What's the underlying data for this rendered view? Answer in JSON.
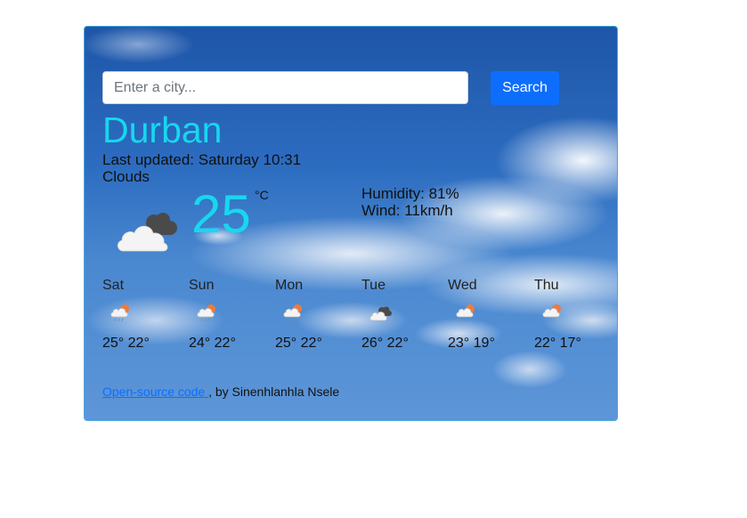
{
  "search": {
    "placeholder": "Enter a city...",
    "value": "",
    "button_label": "Search"
  },
  "current": {
    "city": "Durban",
    "last_updated_label": "Last updated:",
    "last_updated_value": "Saturday 10:31",
    "description": "Clouds",
    "icon": "broken-clouds-icon",
    "temperature": "25",
    "unit": "°C",
    "humidity_label": "Humidity:",
    "humidity_value": "81%",
    "wind_label": "Wind:",
    "wind_value": "11km/h"
  },
  "forecast": [
    {
      "day": "Sat",
      "icon": "light-rain-icon",
      "max": "25°",
      "min": "22°"
    },
    {
      "day": "Sun",
      "icon": "light-rain-icon",
      "max": "24°",
      "min": "22°"
    },
    {
      "day": "Mon",
      "icon": "light-rain-icon",
      "max": "25°",
      "min": "22°"
    },
    {
      "day": "Tue",
      "icon": "broken-clouds-icon",
      "max": "26°",
      "min": "22°"
    },
    {
      "day": "Wed",
      "icon": "light-rain-icon",
      "max": "23°",
      "min": "19°"
    },
    {
      "day": "Thu",
      "icon": "light-rain-icon",
      "max": "22°",
      "min": "17°"
    }
  ],
  "footer": {
    "link_text": "Open-source code ",
    "credit": ", by Sinenhlanhla Nsele"
  },
  "colors": {
    "accent": "#17d7ef",
    "button": "#0d6efd",
    "link": "#0d6efd",
    "card_border": "#4aa3df"
  }
}
